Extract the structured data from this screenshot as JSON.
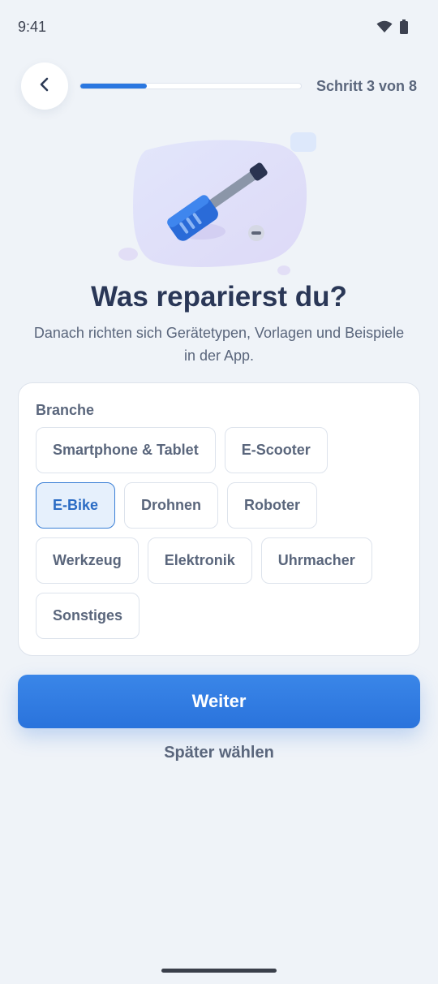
{
  "status_bar": {
    "time": "9:41"
  },
  "header": {
    "step_label": "Schritt 3 von 8",
    "progress": 0.3
  },
  "main": {
    "title": "Was reparierst du?",
    "subtitle": "Danach richten sich Gerätetypen, Vorlagen und Beispiele in der App."
  },
  "branche": {
    "label": "Branche",
    "options": [
      {
        "label": "Smartphone & Tablet",
        "selected": false
      },
      {
        "label": "E-Scooter",
        "selected": false
      },
      {
        "label": "E-Bike",
        "selected": true
      },
      {
        "label": "Drohnen",
        "selected": false
      },
      {
        "label": "Roboter",
        "selected": false
      },
      {
        "label": "Werkzeug",
        "selected": false
      },
      {
        "label": "Elektronik",
        "selected": false
      },
      {
        "label": "Uhrmacher",
        "selected": false
      },
      {
        "label": "Sonstiges",
        "selected": false
      }
    ]
  },
  "actions": {
    "primary_label": "Weiter",
    "secondary_label": "Später wählen"
  },
  "colors": {
    "accent": "#2a77e0",
    "background": "#eff3f8",
    "selected_bg": "#e6f0fc"
  },
  "icons": {
    "back": "chevron-left-icon",
    "wifi": "wifi-icon",
    "battery": "battery-icon",
    "illustration": "screwdriver-illustration"
  }
}
